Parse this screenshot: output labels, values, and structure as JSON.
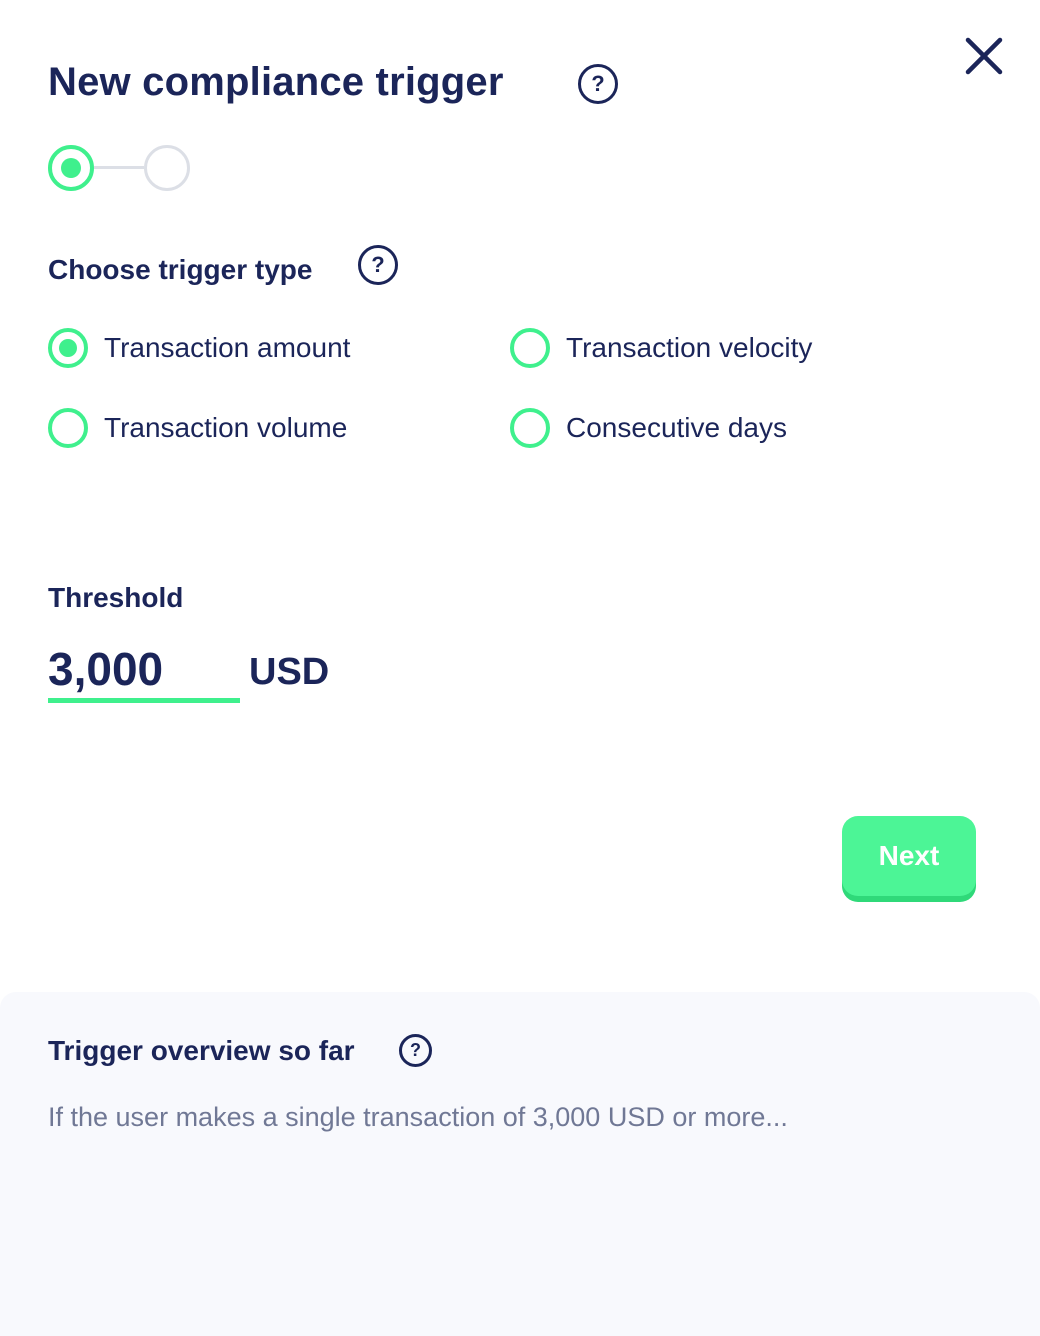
{
  "header": {
    "title": "New compliance trigger",
    "help_icon": "question-circle-icon",
    "close_icon": "close-icon"
  },
  "stepper": {
    "current_step": 1,
    "total_steps": 2
  },
  "trigger_type": {
    "label": "Choose trigger type",
    "options": [
      {
        "label": "Transaction amount",
        "selected": true
      },
      {
        "label": "Transaction velocity",
        "selected": false
      },
      {
        "label": "Transaction volume",
        "selected": false
      },
      {
        "label": "Consecutive days",
        "selected": false
      }
    ]
  },
  "threshold": {
    "label": "Threshold",
    "value": "3,000",
    "currency": "USD"
  },
  "actions": {
    "next_label": "Next"
  },
  "overview": {
    "title": "Trigger overview so far",
    "text": "If the user makes a single transaction of 3,000 USD or more..."
  },
  "colors": {
    "accent": "#3ff08d",
    "text_primary": "#1b2559",
    "text_muted": "#707895",
    "panel_bg": "#f8f9fd"
  }
}
